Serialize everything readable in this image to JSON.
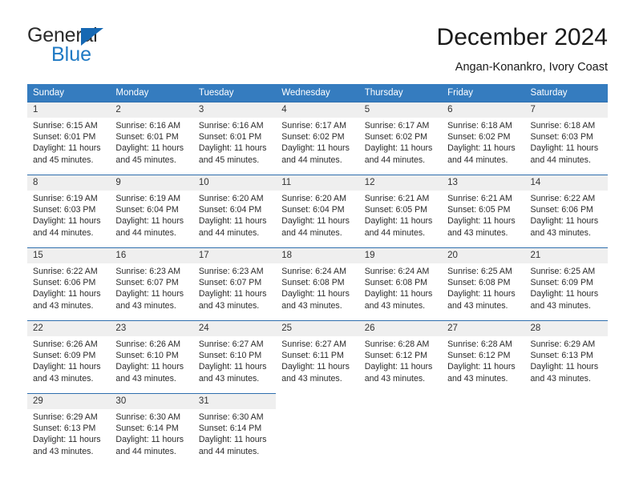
{
  "brand": {
    "name_part1": "General",
    "name_part2": "Blue",
    "accent_color": "#1f7ac4",
    "triangle_color": "#1668b3"
  },
  "header": {
    "title": "December 2024",
    "subtitle": "Angan-Konankro, Ivory Coast"
  },
  "calendar": {
    "header_bg": "#357cbf",
    "header_text_color": "#ffffff",
    "daynum_bg": "#efefef",
    "row_rule_color": "#2f6fae",
    "weekdays": [
      "Sunday",
      "Monday",
      "Tuesday",
      "Wednesday",
      "Thursday",
      "Friday",
      "Saturday"
    ],
    "weeks": [
      [
        {
          "day": "1",
          "sunrise": "Sunrise: 6:15 AM",
          "sunset": "Sunset: 6:01 PM",
          "daylight": "Daylight: 11 hours and 45 minutes."
        },
        {
          "day": "2",
          "sunrise": "Sunrise: 6:16 AM",
          "sunset": "Sunset: 6:01 PM",
          "daylight": "Daylight: 11 hours and 45 minutes."
        },
        {
          "day": "3",
          "sunrise": "Sunrise: 6:16 AM",
          "sunset": "Sunset: 6:01 PM",
          "daylight": "Daylight: 11 hours and 45 minutes."
        },
        {
          "day": "4",
          "sunrise": "Sunrise: 6:17 AM",
          "sunset": "Sunset: 6:02 PM",
          "daylight": "Daylight: 11 hours and 44 minutes."
        },
        {
          "day": "5",
          "sunrise": "Sunrise: 6:17 AM",
          "sunset": "Sunset: 6:02 PM",
          "daylight": "Daylight: 11 hours and 44 minutes."
        },
        {
          "day": "6",
          "sunrise": "Sunrise: 6:18 AM",
          "sunset": "Sunset: 6:02 PM",
          "daylight": "Daylight: 11 hours and 44 minutes."
        },
        {
          "day": "7",
          "sunrise": "Sunrise: 6:18 AM",
          "sunset": "Sunset: 6:03 PM",
          "daylight": "Daylight: 11 hours and 44 minutes."
        }
      ],
      [
        {
          "day": "8",
          "sunrise": "Sunrise: 6:19 AM",
          "sunset": "Sunset: 6:03 PM",
          "daylight": "Daylight: 11 hours and 44 minutes."
        },
        {
          "day": "9",
          "sunrise": "Sunrise: 6:19 AM",
          "sunset": "Sunset: 6:04 PM",
          "daylight": "Daylight: 11 hours and 44 minutes."
        },
        {
          "day": "10",
          "sunrise": "Sunrise: 6:20 AM",
          "sunset": "Sunset: 6:04 PM",
          "daylight": "Daylight: 11 hours and 44 minutes."
        },
        {
          "day": "11",
          "sunrise": "Sunrise: 6:20 AM",
          "sunset": "Sunset: 6:04 PM",
          "daylight": "Daylight: 11 hours and 44 minutes."
        },
        {
          "day": "12",
          "sunrise": "Sunrise: 6:21 AM",
          "sunset": "Sunset: 6:05 PM",
          "daylight": "Daylight: 11 hours and 44 minutes."
        },
        {
          "day": "13",
          "sunrise": "Sunrise: 6:21 AM",
          "sunset": "Sunset: 6:05 PM",
          "daylight": "Daylight: 11 hours and 43 minutes."
        },
        {
          "day": "14",
          "sunrise": "Sunrise: 6:22 AM",
          "sunset": "Sunset: 6:06 PM",
          "daylight": "Daylight: 11 hours and 43 minutes."
        }
      ],
      [
        {
          "day": "15",
          "sunrise": "Sunrise: 6:22 AM",
          "sunset": "Sunset: 6:06 PM",
          "daylight": "Daylight: 11 hours and 43 minutes."
        },
        {
          "day": "16",
          "sunrise": "Sunrise: 6:23 AM",
          "sunset": "Sunset: 6:07 PM",
          "daylight": "Daylight: 11 hours and 43 minutes."
        },
        {
          "day": "17",
          "sunrise": "Sunrise: 6:23 AM",
          "sunset": "Sunset: 6:07 PM",
          "daylight": "Daylight: 11 hours and 43 minutes."
        },
        {
          "day": "18",
          "sunrise": "Sunrise: 6:24 AM",
          "sunset": "Sunset: 6:08 PM",
          "daylight": "Daylight: 11 hours and 43 minutes."
        },
        {
          "day": "19",
          "sunrise": "Sunrise: 6:24 AM",
          "sunset": "Sunset: 6:08 PM",
          "daylight": "Daylight: 11 hours and 43 minutes."
        },
        {
          "day": "20",
          "sunrise": "Sunrise: 6:25 AM",
          "sunset": "Sunset: 6:08 PM",
          "daylight": "Daylight: 11 hours and 43 minutes."
        },
        {
          "day": "21",
          "sunrise": "Sunrise: 6:25 AM",
          "sunset": "Sunset: 6:09 PM",
          "daylight": "Daylight: 11 hours and 43 minutes."
        }
      ],
      [
        {
          "day": "22",
          "sunrise": "Sunrise: 6:26 AM",
          "sunset": "Sunset: 6:09 PM",
          "daylight": "Daylight: 11 hours and 43 minutes."
        },
        {
          "day": "23",
          "sunrise": "Sunrise: 6:26 AM",
          "sunset": "Sunset: 6:10 PM",
          "daylight": "Daylight: 11 hours and 43 minutes."
        },
        {
          "day": "24",
          "sunrise": "Sunrise: 6:27 AM",
          "sunset": "Sunset: 6:10 PM",
          "daylight": "Daylight: 11 hours and 43 minutes."
        },
        {
          "day": "25",
          "sunrise": "Sunrise: 6:27 AM",
          "sunset": "Sunset: 6:11 PM",
          "daylight": "Daylight: 11 hours and 43 minutes."
        },
        {
          "day": "26",
          "sunrise": "Sunrise: 6:28 AM",
          "sunset": "Sunset: 6:12 PM",
          "daylight": "Daylight: 11 hours and 43 minutes."
        },
        {
          "day": "27",
          "sunrise": "Sunrise: 6:28 AM",
          "sunset": "Sunset: 6:12 PM",
          "daylight": "Daylight: 11 hours and 43 minutes."
        },
        {
          "day": "28",
          "sunrise": "Sunrise: 6:29 AM",
          "sunset": "Sunset: 6:13 PM",
          "daylight": "Daylight: 11 hours and 43 minutes."
        }
      ],
      [
        {
          "day": "29",
          "sunrise": "Sunrise: 6:29 AM",
          "sunset": "Sunset: 6:13 PM",
          "daylight": "Daylight: 11 hours and 43 minutes."
        },
        {
          "day": "30",
          "sunrise": "Sunrise: 6:30 AM",
          "sunset": "Sunset: 6:14 PM",
          "daylight": "Daylight: 11 hours and 44 minutes."
        },
        {
          "day": "31",
          "sunrise": "Sunrise: 6:30 AM",
          "sunset": "Sunset: 6:14 PM",
          "daylight": "Daylight: 11 hours and 44 minutes."
        },
        {
          "day": "",
          "sunrise": "",
          "sunset": "",
          "daylight": ""
        },
        {
          "day": "",
          "sunrise": "",
          "sunset": "",
          "daylight": ""
        },
        {
          "day": "",
          "sunrise": "",
          "sunset": "",
          "daylight": ""
        },
        {
          "day": "",
          "sunrise": "",
          "sunset": "",
          "daylight": ""
        }
      ]
    ]
  }
}
